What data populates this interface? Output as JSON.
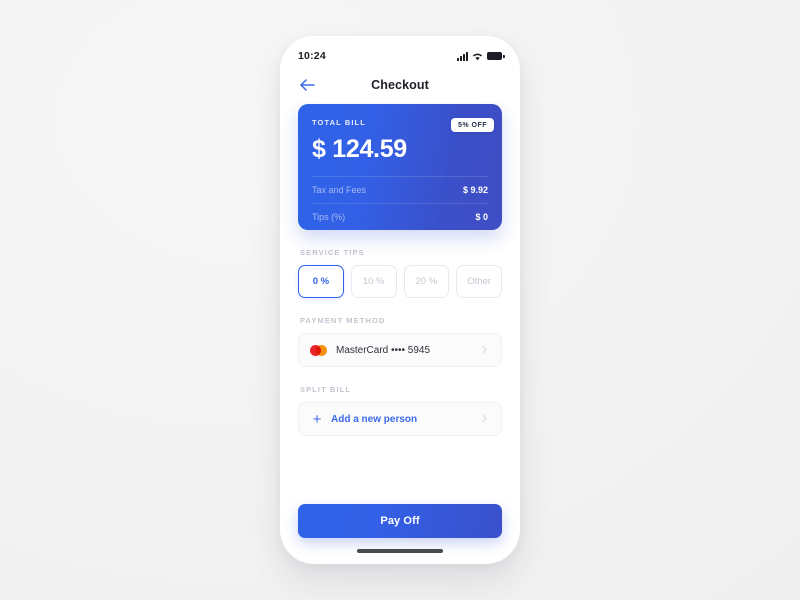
{
  "statusbar": {
    "time": "10:24",
    "signal_icon": "cellular-signal-icon",
    "wifi_icon": "wifi-icon",
    "battery_icon": "battery-icon"
  },
  "navbar": {
    "back_icon": "back-arrow-icon",
    "title": "Checkout"
  },
  "bill_card": {
    "label": "TOTAL BILL",
    "badge": "5% OFF",
    "amount": "$ 124.59",
    "rows": [
      {
        "key": "Tax and Fees",
        "value": "$ 9.92"
      },
      {
        "key": "Tips (%)",
        "value": "$ 0"
      }
    ],
    "gradient_from": "#2e63e8",
    "gradient_to": "#3f4ec4"
  },
  "service_tips": {
    "label": "SERVICE TIPS",
    "options": [
      {
        "label": "0 %",
        "selected": true
      },
      {
        "label": "10 %",
        "selected": false
      },
      {
        "label": "20 %",
        "selected": false
      },
      {
        "label": "Other",
        "selected": false
      }
    ],
    "accent": "#2f62e8"
  },
  "payment_method": {
    "label": "PAYMENT METHOD",
    "card_brand_icon": "mastercard-icon",
    "text": "MasterCard •••• 5945",
    "chevron_icon": "chevron-right-icon"
  },
  "split_bill": {
    "label": "SPLIT BILL",
    "plus_icon": "plus-icon",
    "text": "Add a new person",
    "chevron_icon": "chevron-right-icon"
  },
  "footer": {
    "pay_label": "Pay Off",
    "home_indicator": "home-indicator"
  }
}
